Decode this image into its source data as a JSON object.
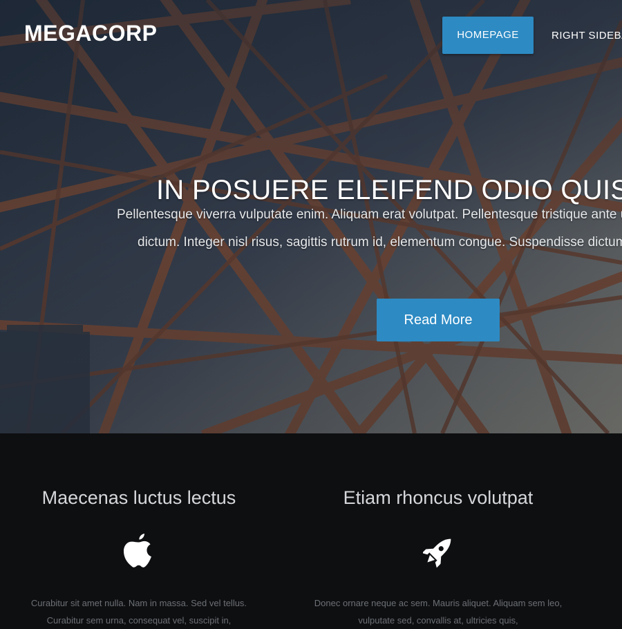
{
  "header": {
    "logo": "MEGACORP",
    "nav": [
      {
        "label": "HOMEPAGE",
        "active": true
      },
      {
        "label": "RIGHT SIDEBAR",
        "active": false
      }
    ]
  },
  "hero": {
    "title": "IN POSUERE ELEIFEND ODIO QUISQUE SEMPER",
    "text_line1": "Pellentesque viverra vulputate enim. Aliquam erat volutpat. Pellentesque tristique ante ut risus.",
    "text_line2": "dictum. Integer nisl risus, sagittis rutrum id, elementum congue. Suspendisse dictum porta.",
    "button": "Read More"
  },
  "features": [
    {
      "title": "Maecenas luctus lectus",
      "icon": "apple-icon",
      "text": "Curabitur sit amet nulla. Nam in massa. Sed vel tellus. Curabitur sem urna, consequat vel, suscipit in,"
    },
    {
      "title": "Etiam rhoncus volutpat",
      "icon": "rocket-icon",
      "text": "Donec ornare neque ac sem. Mauris aliquet. Aliquam sem leo, vulputate sed, convallis at, ultricies quis,"
    }
  ],
  "colors": {
    "accent": "#2d8ac3",
    "dark_bg": "#0e0f11",
    "steel": "#8a5238"
  }
}
